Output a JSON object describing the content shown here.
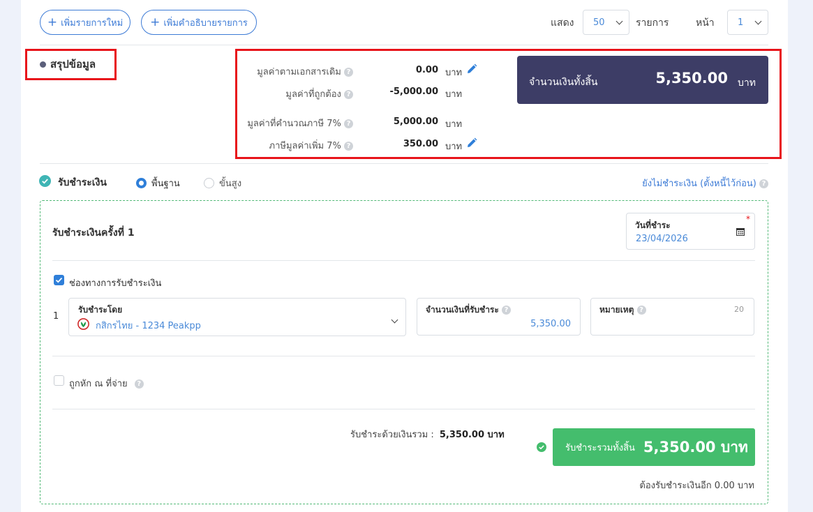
{
  "toolbar": {
    "add_item_label": "เพิ่มรายการใหม่",
    "add_description_label": "เพิ่มคำอธิบายรายการ",
    "show_label": "แสดง",
    "page_size": "50",
    "items_label": "รายการ",
    "page_label": "หน้า",
    "page_number": "1"
  },
  "summary": {
    "title": "สรุปข้อมูล",
    "rows": [
      {
        "label": "มูลค่าตามเอกสารเดิม",
        "value": "0.00",
        "unit": "บาท",
        "editable": true
      },
      {
        "label": "มูลค่าที่ถูกต้อง",
        "value": "-5,000.00",
        "unit": "บาท",
        "editable": false
      },
      {
        "label": "มูลค่าที่คำนวณภาษี 7%",
        "value": "5,000.00",
        "unit": "บาท",
        "editable": false
      },
      {
        "label": "ภาษีมูลค่าเพิ่ม 7%",
        "value": "350.00",
        "unit": "บาท",
        "editable": true
      }
    ],
    "total_label": "จำนวนเงินทั้งสิ้น",
    "total_value": "5,350.00",
    "total_unit": "บาท"
  },
  "payment": {
    "title": "รับชำระเงิน",
    "mode_basic": "พื้นฐาน",
    "mode_advanced": "ขั้นสูง",
    "unpaid_link": "ยังไม่ชำระเงิน (ตั้งหนี้ไว้ก่อน)",
    "round_title": "รับชำระเงินครั้งที่ 1",
    "date_label": "วันที่ชำระ",
    "date_value": "23/04/2026",
    "channel_checkbox_label": "ช่องทางการรับชำระเงิน",
    "row_number": "1",
    "paid_by_label": "รับชำระโดย",
    "paid_by_value": "กสิกรไทย - 1234 Peakpp",
    "amount_label": "จำนวนเงินที่รับชำระ",
    "amount_value": "5,350.00",
    "note_label": "หมายเหตุ",
    "note_counter": "20",
    "withholding_label": "ถูกหัก ณ ที่จ่าย",
    "total_paid_label": "รับชำระด้วยเงินรวม :",
    "total_paid_value": "5,350.00 บาท",
    "grand_button_label": "รับชำระรวมทั้งสิ้น",
    "grand_button_value": "5,350.00 บาท",
    "remaining_label": "ต้องรับชำระเงินอีก 0.00 บาท"
  },
  "colors": {
    "accent_blue": "#2f7fd9",
    "total_box": "#3d3d66",
    "green": "#44bd6d",
    "highlight_red": "#e8141a"
  }
}
